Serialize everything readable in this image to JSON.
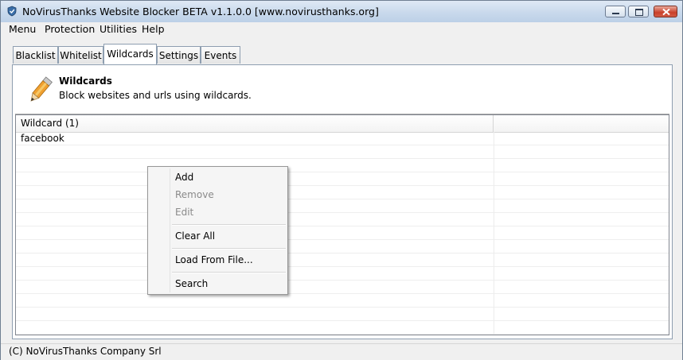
{
  "window": {
    "title": "NoVirusThanks Website Blocker BETA v1.1.0.0 [www.novirusthanks.org]"
  },
  "menubar": [
    "Menu",
    "Protection",
    "Utilities",
    "Help"
  ],
  "tabs": [
    "Blacklist",
    "Whitelist",
    "Wildcards",
    "Settings",
    "Events"
  ],
  "active_tab": "Wildcards",
  "header": {
    "title": "Wildcards",
    "subtitle": "Block websites and urls using wildcards."
  },
  "list": {
    "column_header": "Wildcard (1)",
    "rows": [
      "facebook"
    ]
  },
  "context_menu": {
    "items": [
      "Add",
      "Remove",
      "Edit",
      "Clear All",
      "Load From File...",
      "Search"
    ],
    "disabled": [
      "Remove",
      "Edit"
    ]
  },
  "status": "(C) NoVirusThanks Company Srl",
  "colors": {
    "titlebar": "#c9d9ec",
    "close_button": "#c9402a",
    "pencil": "#f0a030"
  },
  "icons": {
    "app": "shield-icon",
    "header": "pencil-icon"
  }
}
